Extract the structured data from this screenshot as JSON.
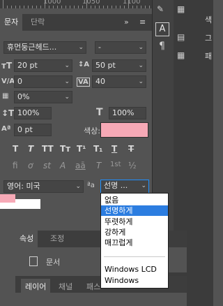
{
  "ruler": {
    "labels": [
      "1000",
      "1050",
      "1100"
    ]
  },
  "character_panel": {
    "tabs": [
      "문자",
      "단락"
    ],
    "font_family": "휴먼둥근헤드...",
    "font_style": "-",
    "font_size": "20 pt",
    "leading": "50 pt",
    "kerning": "0",
    "tracking": "40",
    "tsume": "0%",
    "vertical_scale": "100%",
    "horizontal_scale": "100%",
    "baseline_shift": "0 pt",
    "color_label": "색상:",
    "color": "#f6a9b6",
    "language": "영어: 미국",
    "aa_icon": "ªa",
    "antialias": "선명 ...",
    "style_buttons": [
      "T",
      "T",
      "TT",
      "Tт",
      "T¹",
      "T₁",
      "T",
      "T"
    ],
    "opentype_buttons": [
      "fi",
      "ơ",
      "st",
      "A",
      "aā",
      "T",
      "1st",
      "½"
    ]
  },
  "antialias_menu": {
    "options": [
      "없음",
      "선명하게",
      "뚜렷하게",
      "강하게",
      "매끄럽게",
      "Windows LCD",
      "Windows"
    ],
    "selected": "선명하게"
  },
  "properties_panel": {
    "tabs": [
      "속성",
      "조정"
    ],
    "doc_label": "문서"
  },
  "layers_panel": {
    "tabs": [
      "레이어",
      "채널",
      "패스"
    ]
  },
  "right_panel": {
    "labels": [
      "색",
      "그",
      "패"
    ]
  }
}
